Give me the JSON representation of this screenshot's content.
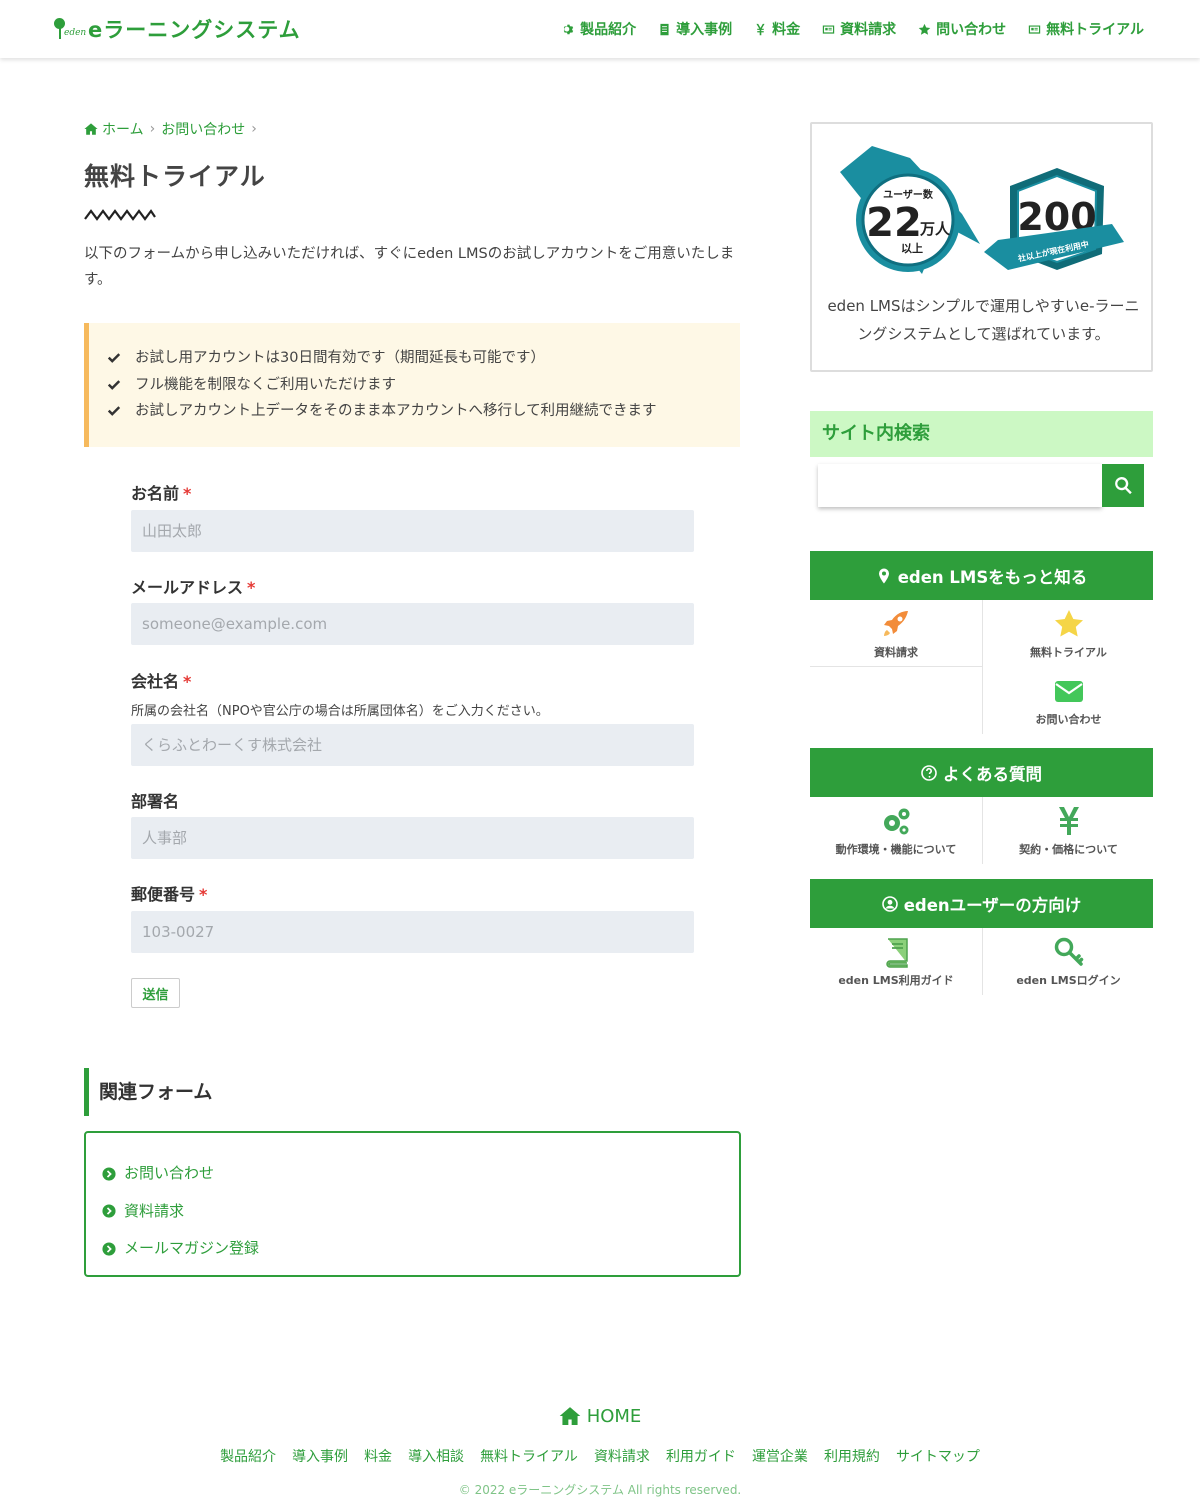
{
  "header": {
    "logo_mark_text": "eden",
    "logo_text": "eラーニングシステム",
    "nav": [
      {
        "label": "製品紹介",
        "icon": "gear-icon"
      },
      {
        "label": "導入事例",
        "icon": "document-icon"
      },
      {
        "label": "料金",
        "icon": "yen-icon"
      },
      {
        "label": "資料請求",
        "icon": "id-card-icon"
      },
      {
        "label": "問い合わせ",
        "icon": "star-icon"
      },
      {
        "label": "無料トライアル",
        "icon": "id-card-icon"
      }
    ]
  },
  "breadcrumb": {
    "home": "ホーム",
    "parent": "お問い合わせ",
    "sep": "›"
  },
  "page": {
    "title": "無料トライアル",
    "intro": "以下のフォームから申し込みいただければ、すぐにeden LMSのお試しアカウントをご用意いたします。"
  },
  "notice": {
    "items": [
      "お試し用アカウントは30日間有効です（期間延長も可能です）",
      "フル機能を制限なくご利用いただけます",
      "お試しアカウント上データをそのまま本アカウントへ移行して利用継続できます"
    ]
  },
  "form": {
    "required_mark": "*",
    "fields": [
      {
        "label": "お名前",
        "required": true,
        "placeholder": "山田太郎"
      },
      {
        "label": "メールアドレス",
        "required": true,
        "placeholder": "someone@example.com"
      },
      {
        "label": "会社名",
        "required": true,
        "help": "所属の会社名（NPOや官公庁の場合は所属団体名）をご入力ください。",
        "placeholder": "くらふとわーくす株式会社"
      },
      {
        "label": "部署名",
        "required": false,
        "placeholder": "人事部"
      },
      {
        "label": "郵便番号",
        "required": true,
        "placeholder": "103-0027"
      }
    ],
    "submit_label": "送信"
  },
  "related": {
    "title": "関連フォーム",
    "items": [
      "お問い合わせ",
      "資料請求",
      "メールマガジン登録"
    ]
  },
  "sidebar": {
    "award": {
      "badge1": {
        "top": "ユーザー数",
        "number": "22",
        "unit": "万人",
        "bottom": "以上"
      },
      "badge2": {
        "number": "200",
        "ribbon": "社以上が現在利用中"
      },
      "text": "eden LMSはシンプルで運用しやすいe-ラーニングシステムとして選ばれています。"
    },
    "search": {
      "title": "サイト内検索",
      "placeholder": ""
    },
    "know_more": {
      "title": "eden LMSをもっと知る",
      "tiles": [
        {
          "label": "資料請求",
          "icon": "rocket-icon"
        },
        {
          "label": "無料トライアル",
          "icon": "star-icon"
        },
        {
          "label": "お問い合わせ",
          "icon": "envelope-icon"
        }
      ]
    },
    "faq": {
      "title": "よくある質問",
      "tiles": [
        {
          "label": "動作環境・機能について",
          "icon": "gears-icon"
        },
        {
          "label": "契約・価格について",
          "icon": "yen-icon"
        }
      ]
    },
    "users": {
      "title": "edenユーザーの方向け",
      "tiles": [
        {
          "label": "eden LMS利用ガイド",
          "icon": "book-icon"
        },
        {
          "label": "eden LMSログイン",
          "icon": "key-icon"
        }
      ]
    }
  },
  "footer": {
    "home": "HOME",
    "links": [
      "製品紹介",
      "導入事例",
      "料金",
      "導入相談",
      "無料トライアル",
      "資料請求",
      "利用ガイド",
      "運営企業",
      "利用規約",
      "サイトマップ"
    ],
    "copyright": "© 2022 eラーニングシステム All rights reserved."
  },
  "colors": {
    "brand_green": "#2e9e3b",
    "notice_bg": "#fef8e6",
    "notice_border": "#f6b95c",
    "search_head_bg": "#ccf8c4",
    "required": "#e53935"
  }
}
